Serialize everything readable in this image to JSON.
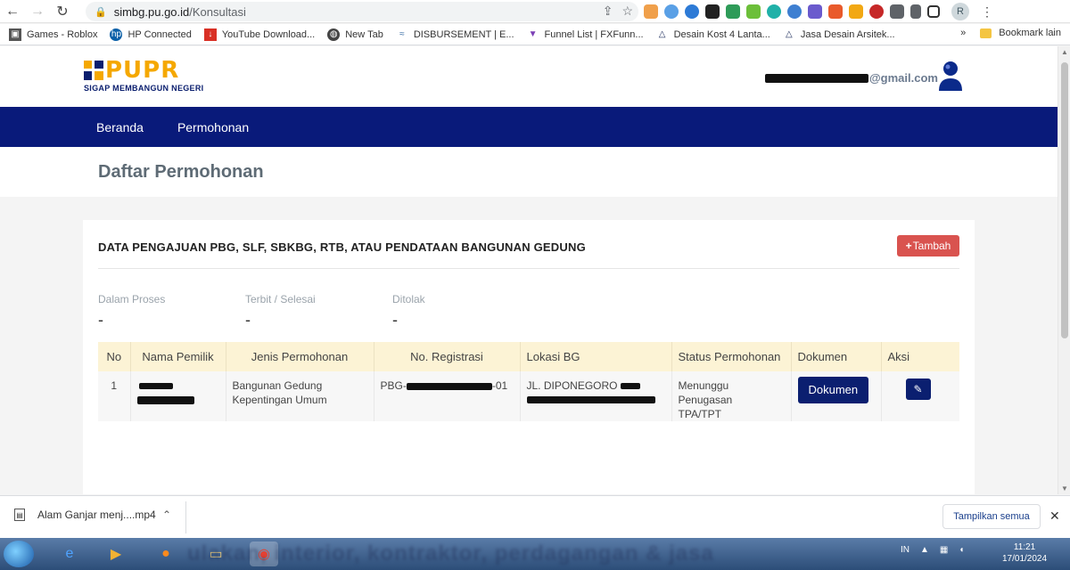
{
  "browser": {
    "url_host": "simbg.pu.go.id",
    "url_path": "/Konsultasi",
    "profile_initial": "R",
    "bookmarks": [
      {
        "label": "Games - Roblox"
      },
      {
        "label": "HP Connected"
      },
      {
        "label": "YouTube Download..."
      },
      {
        "label": "New Tab"
      },
      {
        "label": "DISBURSEMENT | E..."
      },
      {
        "label": "Funnel List | FXFunn..."
      },
      {
        "label": "Desain Kost 4 Lanta..."
      },
      {
        "label": "Jasa Desain Arsitek..."
      }
    ],
    "bookmarks_overflow": "»",
    "bookmark_folder": "Bookmark lain"
  },
  "header": {
    "logo_text": "PUPR",
    "logo_tagline": "SIGAP MEMBANGUN NEGERI",
    "user_email_domain": "@gmail.com"
  },
  "nav": {
    "items": [
      {
        "label": "Beranda"
      },
      {
        "label": "Permohonan"
      }
    ]
  },
  "page": {
    "title": "Daftar Permohonan"
  },
  "card": {
    "heading": "DATA PENGAJUAN PBG, SLF, SBKBG, RTB, ATAU PENDATAAN BANGUNAN GEDUNG",
    "add_button": "Tambah",
    "stats": [
      {
        "label": "Dalam Proses",
        "value": "-"
      },
      {
        "label": "Terbit / Selesai",
        "value": "-"
      },
      {
        "label": "Ditolak",
        "value": "-"
      }
    ]
  },
  "table": {
    "headers": [
      "No",
      "Nama Pemilik",
      "Jenis Permohonan",
      "No. Registrasi",
      "Lokasi BG",
      "Status Permohonan",
      "Dokumen",
      "Aksi"
    ],
    "rows": [
      {
        "no": "1",
        "jenis_line1": "Bangunan Gedung",
        "jenis_line2": "Kepentingan Umum",
        "reg_prefix": "PBG-",
        "reg_suffix": "-01",
        "lokasi_prefix": "JL. DIPONEGORO",
        "status_line1": "Menunggu Penugasan",
        "status_line2": "TPA/TPT",
        "dokumen_button": "Dokumen"
      }
    ]
  },
  "downloads": {
    "file_name": "Alam Ganjar menj....mp4",
    "show_all": "Tampilkan semua"
  },
  "taskbar": {
    "lang": "IN",
    "time": "11:21",
    "date": "17/01/2024",
    "banner_text": "ulakan, interior, kontraktor, perdagangan & jasa"
  },
  "colors": {
    "nav_bg": "#091a7a",
    "brand_yellow": "#f5a800",
    "tambah_red": "#d9534f",
    "table_header": "#fcf3d5",
    "primary_button": "#0b1f70"
  }
}
